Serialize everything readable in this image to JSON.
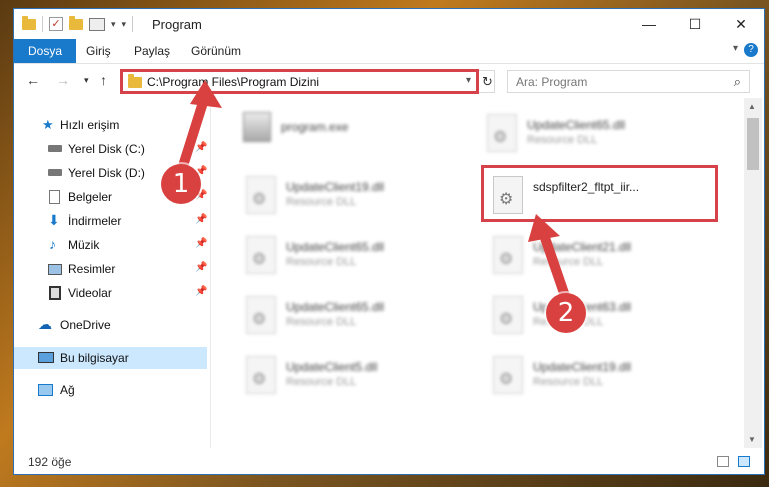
{
  "window": {
    "title": "Program",
    "controls": {
      "minimize": "—",
      "maximize": "☐",
      "close": "✕"
    }
  },
  "ribbon": {
    "tabs": [
      {
        "label": "Dosya"
      },
      {
        "label": "Giriş"
      },
      {
        "label": "Paylaş"
      },
      {
        "label": "Görünüm"
      }
    ],
    "help": "?"
  },
  "address": {
    "path": "C:\\Program Files\\Program Dizini",
    "search_placeholder": "Ara: Program"
  },
  "nav": {
    "items": [
      {
        "label": "Hızlı erişim",
        "icon": "star-icon"
      },
      {
        "label": "Yerel Disk (C:)",
        "icon": "drive-icon",
        "pinned": true
      },
      {
        "label": "Yerel Disk (D:)",
        "icon": "drive-icon",
        "pinned": true
      },
      {
        "label": "Belgeler",
        "icon": "documents-icon",
        "pinned": true
      },
      {
        "label": "İndirmeler",
        "icon": "download-icon",
        "pinned": true
      },
      {
        "label": "Müzik",
        "icon": "music-icon",
        "pinned": true
      },
      {
        "label": "Resimler",
        "icon": "pictures-icon",
        "pinned": true
      },
      {
        "label": "Videolar",
        "icon": "videos-icon",
        "pinned": true
      },
      {
        "label": "OneDrive",
        "icon": "cloud-icon"
      },
      {
        "label": "Bu bilgisayar",
        "icon": "computer-icon",
        "selected": true
      },
      {
        "label": "Ağ",
        "icon": "network-icon"
      }
    ]
  },
  "files": [
    {
      "name": "program.exe",
      "type": ""
    },
    {
      "name": "UpdateClient65.dll",
      "type": "Resource DLL"
    },
    {
      "name": "UpdateClient19.dll",
      "type": "Resource DLL"
    },
    {
      "name": "sdspfilter2_fltpt_iir...",
      "type": ""
    },
    {
      "name": "UpdateClient65.dll",
      "type": "Resource DLL"
    },
    {
      "name": "UpdateClient21.dll",
      "type": "Resource DLL"
    },
    {
      "name": "UpdateClient65.dll",
      "type": "Resource DLL"
    },
    {
      "name": "UpdateClient63.dll",
      "type": "Resource DLL"
    },
    {
      "name": "UpdateClient5.dll",
      "type": "Resource DLL"
    },
    {
      "name": "UpdateClient19.dll",
      "type": "Resource DLL"
    }
  ],
  "status": {
    "count": "192 öğe"
  },
  "annotations": {
    "step1": "1",
    "step2": "2"
  },
  "colors": {
    "accent": "#1979ca",
    "highlight": "#d6424a",
    "selection": "#cce8ff"
  }
}
